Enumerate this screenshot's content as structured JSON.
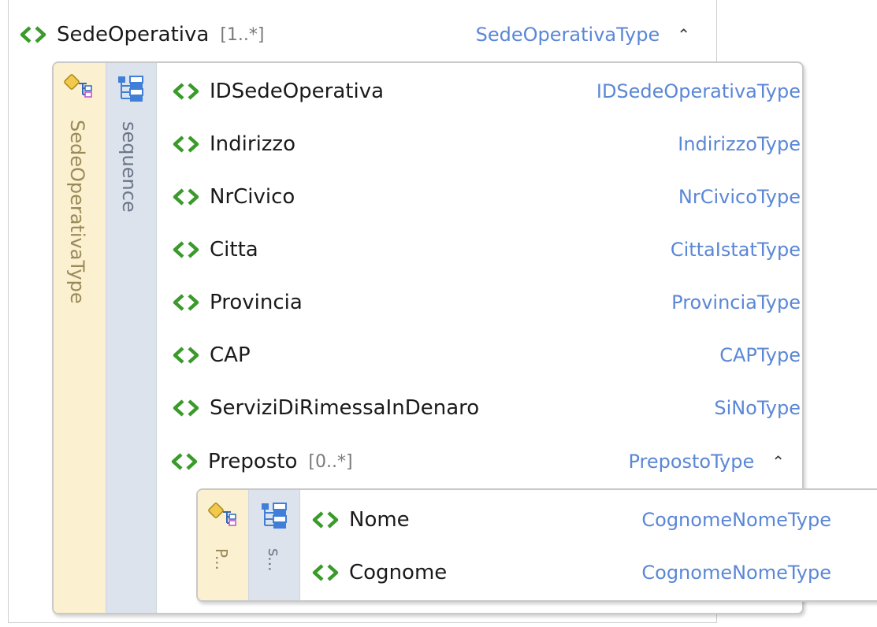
{
  "root": {
    "name": "SedeOperativa",
    "multiplicity": "[1..*]",
    "type": "SedeOperativaType"
  },
  "complex_type": {
    "label": "SedeOperativaType",
    "compositor": "sequence",
    "elements": [
      {
        "name": "IDSedeOperativa",
        "type": "IDSedeOperativaType"
      },
      {
        "name": "Indirizzo",
        "type": "IndirizzoType"
      },
      {
        "name": "NrCivico",
        "type": "NrCivicoType"
      },
      {
        "name": "Citta",
        "type": "CittaIstatType"
      },
      {
        "name": "Provincia",
        "type": "ProvinciaType"
      },
      {
        "name": "CAP",
        "type": "CAPType"
      },
      {
        "name": "ServiziDiRimessaInDenaro",
        "type": "SiNoType"
      }
    ],
    "preposto": {
      "name": "Preposto",
      "multiplicity": "[0..*]",
      "type": "PrepostoType"
    }
  },
  "nested_type": {
    "label": "P...",
    "compositor": "s...",
    "elements": [
      {
        "name": "Nome",
        "type": "CognomeNomeType"
      },
      {
        "name": "Cognome",
        "type": "CognomeNomeType"
      }
    ]
  },
  "icons": {
    "element": "element-icon",
    "complex_type": "complex-type-icon",
    "sequence": "sequence-icon",
    "collapse": "collapse-icon"
  },
  "colors": {
    "element_icon": "#3a9a2a",
    "type_text": "#5a87d6",
    "type_strip": "#fbf0cf",
    "sequence_strip": "#dde3ec"
  }
}
